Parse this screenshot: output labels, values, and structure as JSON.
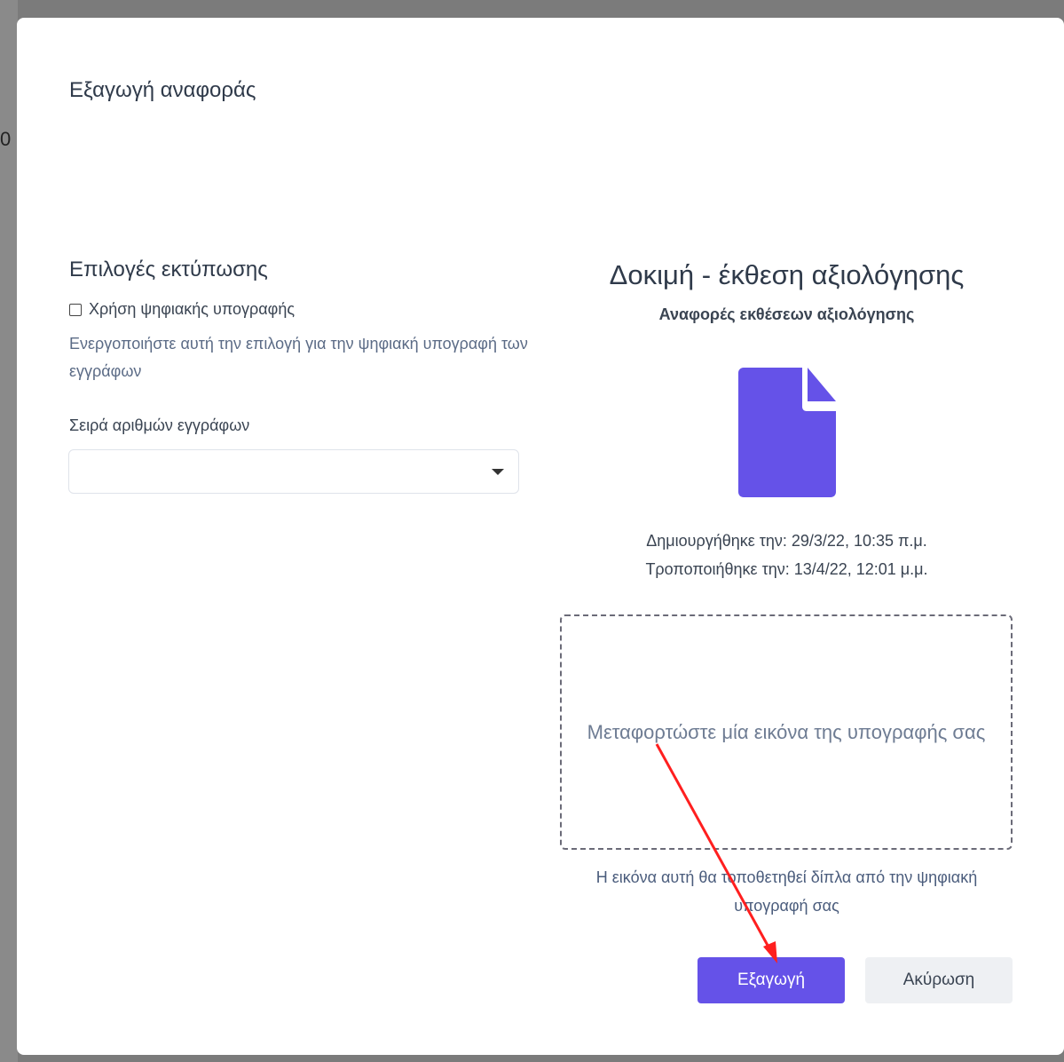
{
  "backdrop": {
    "partial_char": "0"
  },
  "dialog": {
    "title": "Εξαγωγή αναφοράς",
    "print_options": {
      "heading": "Επιλογές εκτύπωσης",
      "digital_signature_checkbox": {
        "label": "Χρήση ψηφιακής υπογραφής",
        "checked": false
      },
      "help_text": "Ενεργοποιήστε αυτή την επιλογή για την ψηφιακή υπογραφή των εγγράφων",
      "series_label": "Σειρά αριθμών εγγράφων",
      "series_value": ""
    },
    "document": {
      "title": "Δοκιμή - έκθεση αξιολόγησης",
      "subtitle": "Αναφορές εκθέσεων αξιολόγησης",
      "icon": "file-icon",
      "icon_color": "#6552e8",
      "created": "Δημιουργήθηκε την: 29/3/22, 10:35 π.μ.",
      "modified": "Τροποποιήθηκε την: 13/4/22, 12:01 μ.μ."
    },
    "signature_upload": {
      "prompt": "Μεταφορτώστε μία εικόνα της υπογραφής σας",
      "note": "Η εικόνα αυτή θα τοποθετηθεί δίπλα από την ψηφιακή υπογραφή σας"
    },
    "buttons": {
      "export": "Εξαγωγή",
      "cancel": "Ακύρωση",
      "export_color": "#6552e8"
    }
  }
}
